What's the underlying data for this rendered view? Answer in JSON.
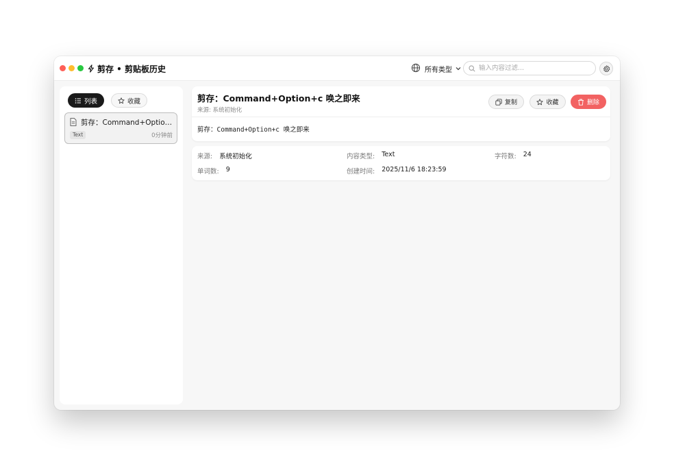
{
  "app": {
    "title": "剪存 • 剪贴板历史"
  },
  "toolbar": {
    "type_filter": "所有类型",
    "search_placeholder": "输入内容过滤..."
  },
  "sidebar": {
    "tabs": [
      {
        "label": "列表"
      },
      {
        "label": "收藏"
      }
    ],
    "items": [
      {
        "title": "剪存：Command+Option+c 唤之即来",
        "tag": "Text",
        "time": "0分钟前"
      }
    ]
  },
  "detail": {
    "title": "剪存：Command+Option+c 唤之即来",
    "source_line": "来源: 系统初始化",
    "content": "剪存：Command+Option+c 唤之即来",
    "buttons": {
      "copy": "复制",
      "favorite": "收藏",
      "delete": "删除"
    }
  },
  "meta": {
    "source": {
      "label": "来源:",
      "value": "系统初始化"
    },
    "content_type": {
      "label": "内容类型:",
      "value": "Text"
    },
    "char_count": {
      "label": "字符数:",
      "value": "24"
    },
    "word_count": {
      "label": "单词数:",
      "value": "9"
    },
    "created_at": {
      "label": "创建时间:",
      "value": "2025/11/6 18:23:59"
    }
  },
  "colors": {
    "accent_dark": "#1a1a1a",
    "danger": "#f26262",
    "traffic_red": "#fe5f57",
    "traffic_yellow": "#febc2e",
    "traffic_green": "#28c840"
  },
  "icons": [
    "bolt-icon",
    "globe-icon",
    "chevron-down-icon",
    "search-icon",
    "gear-icon",
    "list-icon",
    "star-icon",
    "document-icon",
    "copy-icon",
    "trash-icon"
  ]
}
